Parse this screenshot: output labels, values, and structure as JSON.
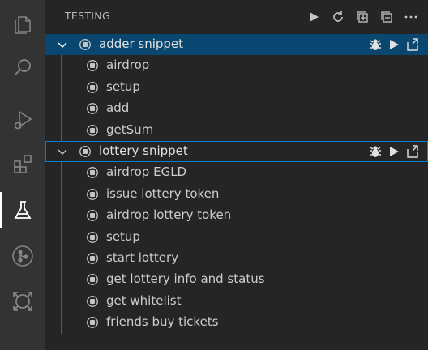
{
  "activity_bar": {
    "items": [
      {
        "icon": "explorer-icon",
        "active": false
      },
      {
        "icon": "search-icon",
        "active": false
      },
      {
        "icon": "run-debug-icon",
        "active": false
      },
      {
        "icon": "extensions-icon",
        "active": false
      },
      {
        "icon": "testing-flask-icon",
        "active": true
      },
      {
        "icon": "source-control-icon",
        "active": false
      },
      {
        "icon": "remote-explorer-icon",
        "active": false
      }
    ]
  },
  "header": {
    "title": "TESTING",
    "actions": [
      "run-all-icon",
      "refresh-icon",
      "expand-all-icon",
      "collapse-all-icon",
      "more-actions-icon"
    ]
  },
  "tree": {
    "groups": [
      {
        "label": "adder snippet",
        "expanded": true,
        "children": [
          "airdrop",
          "setup",
          "add",
          "getSum"
        ]
      },
      {
        "label": "lottery snippet",
        "expanded": true,
        "children": [
          "airdrop EGLD",
          "issue lottery token",
          "airdrop lottery token",
          "setup",
          "start lottery",
          "get lottery info and status",
          "get whitelist",
          "friends buy tickets"
        ]
      }
    ],
    "row_actions": [
      "debug-icon",
      "run-icon",
      "open-file-icon"
    ]
  },
  "colors": {
    "selection": "#094771",
    "focus_border": "#007fd4",
    "icon": "#c5c5c5"
  }
}
